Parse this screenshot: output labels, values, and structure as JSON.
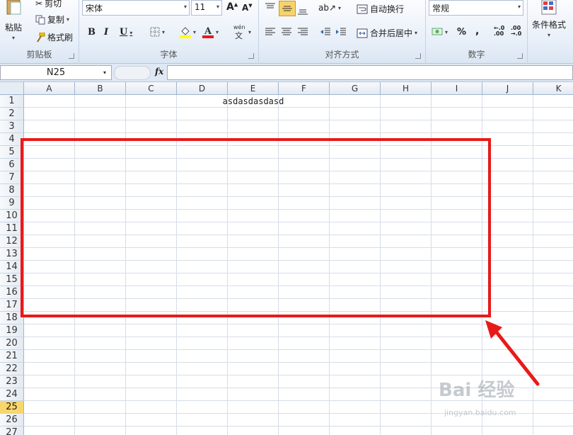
{
  "ribbon": {
    "clipboard": {
      "paste_label": "粘贴",
      "cut_label": "剪切",
      "copy_label": "复制",
      "format_painter_label": "格式刷",
      "group_label": "剪贴板"
    },
    "font": {
      "font_name": "宋体",
      "font_size": "11",
      "bold_label": "B",
      "italic_label": "I",
      "underline_label": "U",
      "phonetic_label": "wén",
      "group_label": "字体"
    },
    "alignment": {
      "wrap_text_label": "自动换行",
      "merge_center_label": "合并后居中",
      "group_label": "对齐方式"
    },
    "number": {
      "format_value": "常规",
      "percent_label": "%",
      "comma_label": ",",
      "group_label": "数字"
    },
    "styles": {
      "conditional_format_label": "条件格式"
    }
  },
  "formula_bar": {
    "name_box": "N25",
    "fx_label": "fx",
    "formula": ""
  },
  "sheet": {
    "columns": [
      "A",
      "B",
      "C",
      "D",
      "E",
      "F",
      "G",
      "H",
      "I",
      "J",
      "K"
    ],
    "rows": [
      "1",
      "2",
      "3",
      "4",
      "5",
      "6",
      "7",
      "8",
      "9",
      "10",
      "11",
      "12",
      "13",
      "14",
      "15",
      "16",
      "17",
      "18",
      "19",
      "20",
      "21",
      "22",
      "23",
      "24",
      "25",
      "26",
      "27"
    ],
    "active_row": "25",
    "cell_E1": "asdasdasdasd"
  },
  "watermark": {
    "brand": "Bai 经验",
    "url": "jingyan.baidu.com"
  },
  "colors": {
    "highlight": "#e81a1a",
    "active_row_header": "#f9d66b"
  }
}
